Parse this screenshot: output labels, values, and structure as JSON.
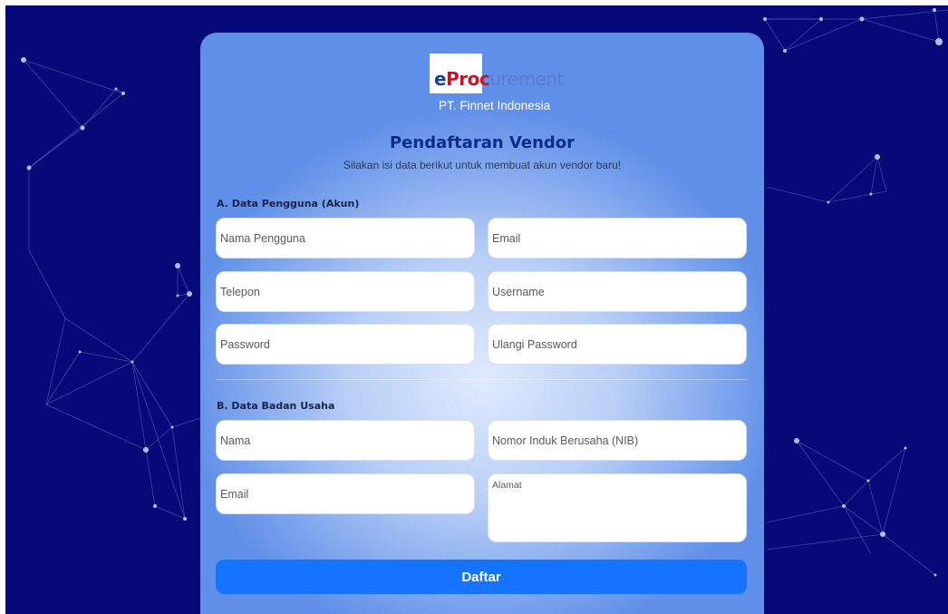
{
  "logo": {
    "e": "e",
    "proc": "Proc",
    "urement": "urement",
    "company": "PT. Finnet Indonesia"
  },
  "header": {
    "title": "Pendaftaran Vendor",
    "subtitle": "Silakan isi data berikut untuk membuat akun vendor baru!"
  },
  "section_a": {
    "label": "A. Data Pengguna (Akun)",
    "fields": {
      "nama_pengguna": "Nama Pengguna",
      "email": "Email",
      "telepon": "Telepon",
      "username": "Username",
      "password": "Password",
      "ulangi_password": "Ulangi Password"
    }
  },
  "section_b": {
    "label": "B. Data Badan Usaha",
    "fields": {
      "nama": "Nama",
      "nib": "Nomor Induk Berusaha (NIB)",
      "email": "Email",
      "alamat": "Alamat"
    }
  },
  "submit_label": "Daftar",
  "colors": {
    "background": "#050a78",
    "button": "#1473ff",
    "title": "#0c2c8c"
  }
}
